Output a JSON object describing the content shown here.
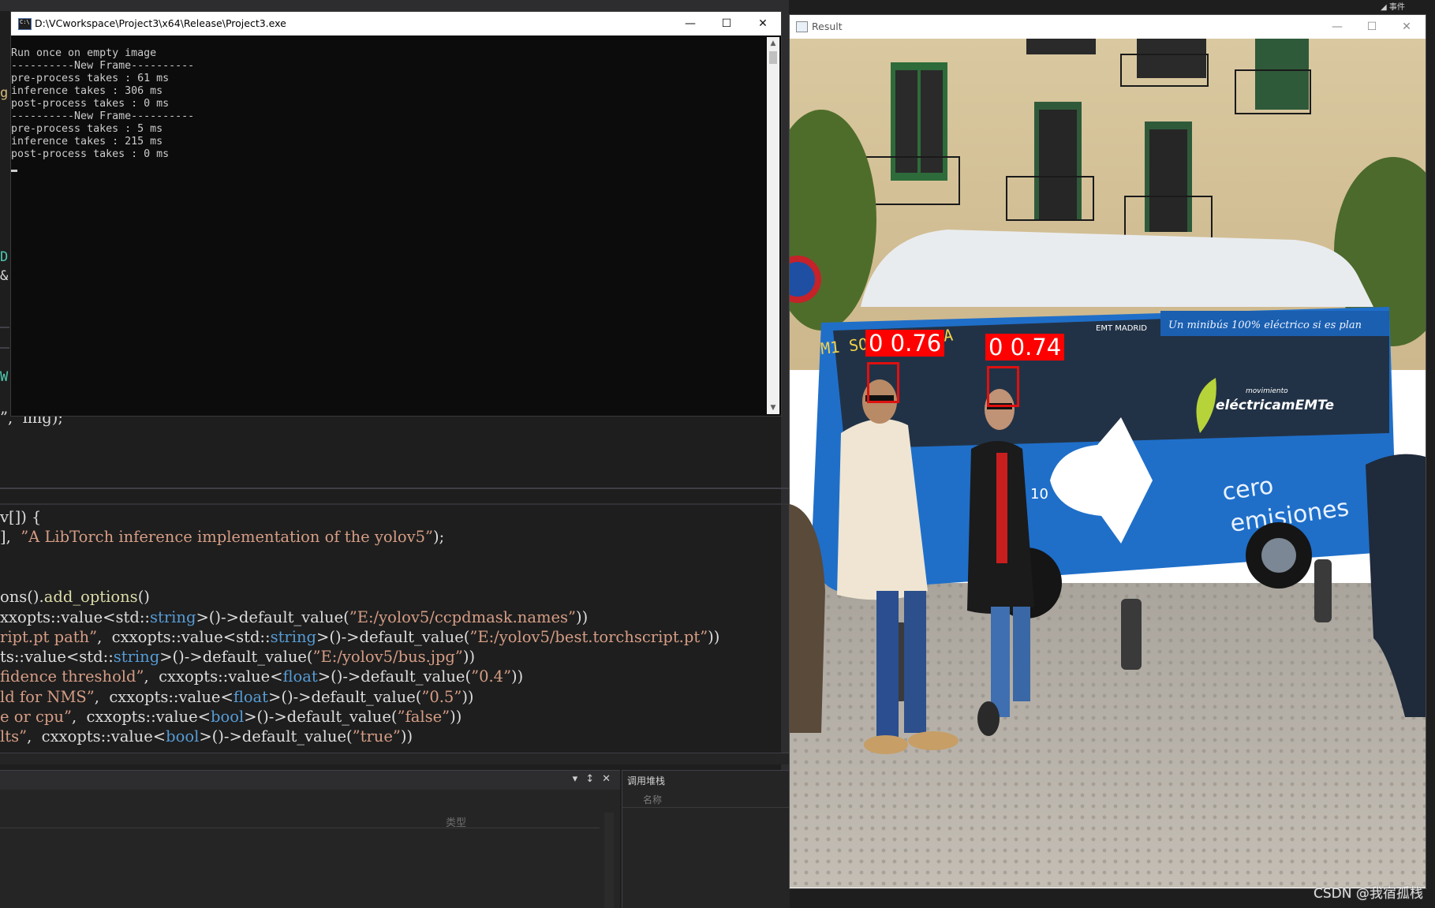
{
  "top_right_strip": "◢ 事件",
  "ide": {
    "gutter_chars": [
      "g",
      "D",
      "&",
      "W"
    ],
    "code_lines_top": [
      {
        "segments": [
          {
            "t": "”,  img);",
            "c": "t-pl"
          }
        ]
      }
    ],
    "code_lines": [
      {
        "segments": [
          {
            "t": "v[]) {",
            "c": "t-pl"
          }
        ]
      },
      {
        "segments": [
          {
            "t": "],  ",
            "c": "t-pl"
          },
          {
            "t": "”A LibTorch inference implementation of the yolov5”",
            "c": "t-str"
          },
          {
            "t": ");",
            "c": "t-pl"
          }
        ]
      },
      {
        "segments": []
      },
      {
        "segments": []
      },
      {
        "segments": [
          {
            "t": "ons().",
            "c": "t-pl"
          },
          {
            "t": "add_options",
            "c": "t-fn"
          },
          {
            "t": "()",
            "c": "t-pl"
          }
        ]
      },
      {
        "segments": [
          {
            "t": "xxopts::value<std::",
            "c": "t-pl"
          },
          {
            "t": "string",
            "c": "t-kw"
          },
          {
            "t": ">()->default_value(",
            "c": "t-pl"
          },
          {
            "t": "”E:/yolov5/ccpdmask.names”",
            "c": "t-str"
          },
          {
            "t": "))",
            "c": "t-pl"
          }
        ]
      },
      {
        "segments": [
          {
            "t": "ript.pt path”",
            "c": "t-str"
          },
          {
            "t": ",  cxxopts::value<std::",
            "c": "t-pl"
          },
          {
            "t": "string",
            "c": "t-kw"
          },
          {
            "t": ">()->default_value(",
            "c": "t-pl"
          },
          {
            "t": "”E:/yolov5/best.torchscript.pt”",
            "c": "t-str"
          },
          {
            "t": "))",
            "c": "t-pl"
          }
        ]
      },
      {
        "segments": [
          {
            "t": "ts::value<std::",
            "c": "t-pl"
          },
          {
            "t": "string",
            "c": "t-kw"
          },
          {
            "t": ">()->default_value(",
            "c": "t-pl"
          },
          {
            "t": "”E:/yolov5/bus.jpg”",
            "c": "t-str"
          },
          {
            "t": "))",
            "c": "t-pl"
          }
        ]
      },
      {
        "segments": [
          {
            "t": "fidence threshold”",
            "c": "t-str"
          },
          {
            "t": ",  cxxopts::value<",
            "c": "t-pl"
          },
          {
            "t": "float",
            "c": "t-kw"
          },
          {
            "t": ">()->default_value(",
            "c": "t-pl"
          },
          {
            "t": "”0.4”",
            "c": "t-str"
          },
          {
            "t": "))",
            "c": "t-pl"
          }
        ]
      },
      {
        "segments": [
          {
            "t": "ld for NMS”",
            "c": "t-str"
          },
          {
            "t": ",  cxxopts::value<",
            "c": "t-pl"
          },
          {
            "t": "float",
            "c": "t-kw"
          },
          {
            "t": ">()->default_value(",
            "c": "t-pl"
          },
          {
            "t": "”0.5”",
            "c": "t-str"
          },
          {
            "t": "))",
            "c": "t-pl"
          }
        ]
      },
      {
        "segments": [
          {
            "t": "e or cpu”",
            "c": "t-str"
          },
          {
            "t": ",  cxxopts::value<",
            "c": "t-pl"
          },
          {
            "t": "bool",
            "c": "t-kw"
          },
          {
            "t": ">()->default_value(",
            "c": "t-pl"
          },
          {
            "t": "”false”",
            "c": "t-str"
          },
          {
            "t": "))",
            "c": "t-pl"
          }
        ]
      },
      {
        "segments": [
          {
            "t": "lts”",
            "c": "t-str"
          },
          {
            "t": ",  cxxopts::value<",
            "c": "t-pl"
          },
          {
            "t": "bool",
            "c": "t-kw"
          },
          {
            "t": ">()->default_value(",
            "c": "t-pl"
          },
          {
            "t": "”true”",
            "c": "t-str"
          },
          {
            "t": "))",
            "c": "t-pl"
          }
        ]
      }
    ],
    "bottom_left_panel": {
      "tools": [
        "▾",
        "↕",
        "✕"
      ],
      "column_type": "类型"
    },
    "bottom_right_panel": {
      "title": "调用堆栈",
      "column_name": "名称"
    }
  },
  "console": {
    "title": "D:\\VCworkspace\\Project3\\x64\\Release\\Project3.exe",
    "buttons": [
      "—",
      "☐",
      "✕"
    ],
    "lines": [
      "Run once on empty image",
      "----------New Frame----------",
      "pre-process takes : 61 ms",
      "inference takes : 306 ms",
      "post-process takes : 0 ms",
      "----------New Frame----------",
      "pre-process takes : 5 ms",
      "inference takes : 215 ms",
      "post-process takes : 0 ms"
    ],
    "scroll_up": "▲",
    "scroll_down": "▼"
  },
  "result": {
    "title": "Result",
    "buttons": [
      "—",
      "☐",
      "✕"
    ],
    "detections": [
      {
        "label": "0 0.76",
        "class_id": "0",
        "confidence": 0.76
      },
      {
        "label": "0 0.74",
        "class_id": "0",
        "confidence": 0.74
      }
    ],
    "scene": {
      "bus_route_sign": "M1 SOL/SEVILLA",
      "bus_brand": "EMT MADRID",
      "bus_ad": "Un minibús 100% eléctrico si es plan",
      "bus_ad_logo": "eléctricamEMTe",
      "bus_ad_logo_small": "movimiento",
      "bus_slogan_1": "cero",
      "bus_slogan_2": "emisiones",
      "bus_number": "10",
      "bus_number_left": "010",
      "colors": {
        "bus_blue": "#1f6fc9",
        "bus_white": "#e8ecef",
        "building": "#d4c09a",
        "street": "#b7b1a8",
        "box": "#ff0000"
      }
    }
  },
  "watermark": "CSDN @我宿孤栈"
}
